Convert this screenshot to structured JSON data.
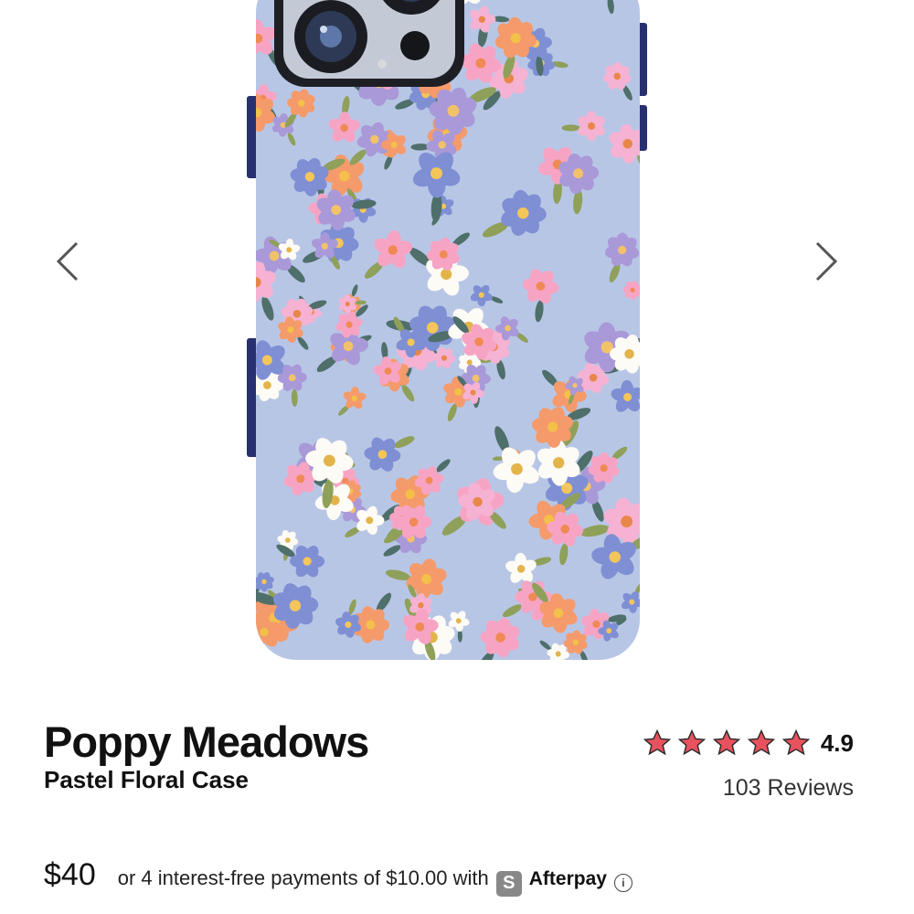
{
  "product": {
    "name": "Poppy Meadows",
    "subtitle": "Pastel Floral Case",
    "rating": "4.9",
    "stars": 5,
    "reviews_label": "103 Reviews"
  },
  "pricing": {
    "price": "$40",
    "installment_text": "or 4 interest-free payments of $10.00 with",
    "afterpay_logo": "S",
    "afterpay_name": "Afterpay",
    "info_icon": "i"
  },
  "colors": {
    "star": "#e8525e",
    "case_background": "#b8c6e6",
    "case_frame": "#28306f"
  },
  "icons": {
    "prev": "chevron-left-icon",
    "next": "chevron-right-icon"
  }
}
